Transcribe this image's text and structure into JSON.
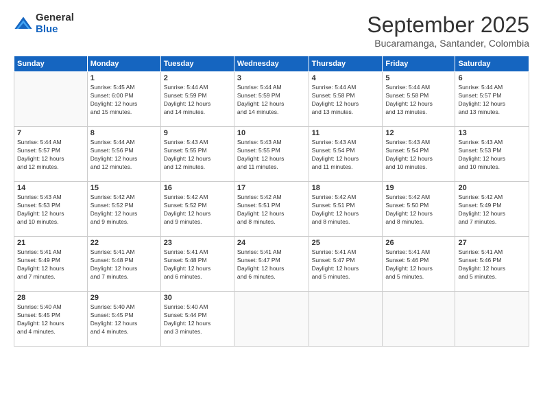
{
  "logo": {
    "general": "General",
    "blue": "Blue"
  },
  "title": "September 2025",
  "subtitle": "Bucaramanga, Santander, Colombia",
  "days": [
    "Sunday",
    "Monday",
    "Tuesday",
    "Wednesday",
    "Thursday",
    "Friday",
    "Saturday"
  ],
  "weeks": [
    [
      {
        "num": "",
        "info": ""
      },
      {
        "num": "1",
        "info": "Sunrise: 5:45 AM\nSunset: 6:00 PM\nDaylight: 12 hours\nand 15 minutes."
      },
      {
        "num": "2",
        "info": "Sunrise: 5:44 AM\nSunset: 5:59 PM\nDaylight: 12 hours\nand 14 minutes."
      },
      {
        "num": "3",
        "info": "Sunrise: 5:44 AM\nSunset: 5:59 PM\nDaylight: 12 hours\nand 14 minutes."
      },
      {
        "num": "4",
        "info": "Sunrise: 5:44 AM\nSunset: 5:58 PM\nDaylight: 12 hours\nand 13 minutes."
      },
      {
        "num": "5",
        "info": "Sunrise: 5:44 AM\nSunset: 5:58 PM\nDaylight: 12 hours\nand 13 minutes."
      },
      {
        "num": "6",
        "info": "Sunrise: 5:44 AM\nSunset: 5:57 PM\nDaylight: 12 hours\nand 13 minutes."
      }
    ],
    [
      {
        "num": "7",
        "info": "Sunrise: 5:44 AM\nSunset: 5:57 PM\nDaylight: 12 hours\nand 12 minutes."
      },
      {
        "num": "8",
        "info": "Sunrise: 5:44 AM\nSunset: 5:56 PM\nDaylight: 12 hours\nand 12 minutes."
      },
      {
        "num": "9",
        "info": "Sunrise: 5:43 AM\nSunset: 5:55 PM\nDaylight: 12 hours\nand 12 minutes."
      },
      {
        "num": "10",
        "info": "Sunrise: 5:43 AM\nSunset: 5:55 PM\nDaylight: 12 hours\nand 11 minutes."
      },
      {
        "num": "11",
        "info": "Sunrise: 5:43 AM\nSunset: 5:54 PM\nDaylight: 12 hours\nand 11 minutes."
      },
      {
        "num": "12",
        "info": "Sunrise: 5:43 AM\nSunset: 5:54 PM\nDaylight: 12 hours\nand 10 minutes."
      },
      {
        "num": "13",
        "info": "Sunrise: 5:43 AM\nSunset: 5:53 PM\nDaylight: 12 hours\nand 10 minutes."
      }
    ],
    [
      {
        "num": "14",
        "info": "Sunrise: 5:43 AM\nSunset: 5:53 PM\nDaylight: 12 hours\nand 10 minutes."
      },
      {
        "num": "15",
        "info": "Sunrise: 5:42 AM\nSunset: 5:52 PM\nDaylight: 12 hours\nand 9 minutes."
      },
      {
        "num": "16",
        "info": "Sunrise: 5:42 AM\nSunset: 5:52 PM\nDaylight: 12 hours\nand 9 minutes."
      },
      {
        "num": "17",
        "info": "Sunrise: 5:42 AM\nSunset: 5:51 PM\nDaylight: 12 hours\nand 8 minutes."
      },
      {
        "num": "18",
        "info": "Sunrise: 5:42 AM\nSunset: 5:51 PM\nDaylight: 12 hours\nand 8 minutes."
      },
      {
        "num": "19",
        "info": "Sunrise: 5:42 AM\nSunset: 5:50 PM\nDaylight: 12 hours\nand 8 minutes."
      },
      {
        "num": "20",
        "info": "Sunrise: 5:42 AM\nSunset: 5:49 PM\nDaylight: 12 hours\nand 7 minutes."
      }
    ],
    [
      {
        "num": "21",
        "info": "Sunrise: 5:41 AM\nSunset: 5:49 PM\nDaylight: 12 hours\nand 7 minutes."
      },
      {
        "num": "22",
        "info": "Sunrise: 5:41 AM\nSunset: 5:48 PM\nDaylight: 12 hours\nand 7 minutes."
      },
      {
        "num": "23",
        "info": "Sunrise: 5:41 AM\nSunset: 5:48 PM\nDaylight: 12 hours\nand 6 minutes."
      },
      {
        "num": "24",
        "info": "Sunrise: 5:41 AM\nSunset: 5:47 PM\nDaylight: 12 hours\nand 6 minutes."
      },
      {
        "num": "25",
        "info": "Sunrise: 5:41 AM\nSunset: 5:47 PM\nDaylight: 12 hours\nand 5 minutes."
      },
      {
        "num": "26",
        "info": "Sunrise: 5:41 AM\nSunset: 5:46 PM\nDaylight: 12 hours\nand 5 minutes."
      },
      {
        "num": "27",
        "info": "Sunrise: 5:41 AM\nSunset: 5:46 PM\nDaylight: 12 hours\nand 5 minutes."
      }
    ],
    [
      {
        "num": "28",
        "info": "Sunrise: 5:40 AM\nSunset: 5:45 PM\nDaylight: 12 hours\nand 4 minutes."
      },
      {
        "num": "29",
        "info": "Sunrise: 5:40 AM\nSunset: 5:45 PM\nDaylight: 12 hours\nand 4 minutes."
      },
      {
        "num": "30",
        "info": "Sunrise: 5:40 AM\nSunset: 5:44 PM\nDaylight: 12 hours\nand 3 minutes."
      },
      {
        "num": "",
        "info": ""
      },
      {
        "num": "",
        "info": ""
      },
      {
        "num": "",
        "info": ""
      },
      {
        "num": "",
        "info": ""
      }
    ]
  ]
}
